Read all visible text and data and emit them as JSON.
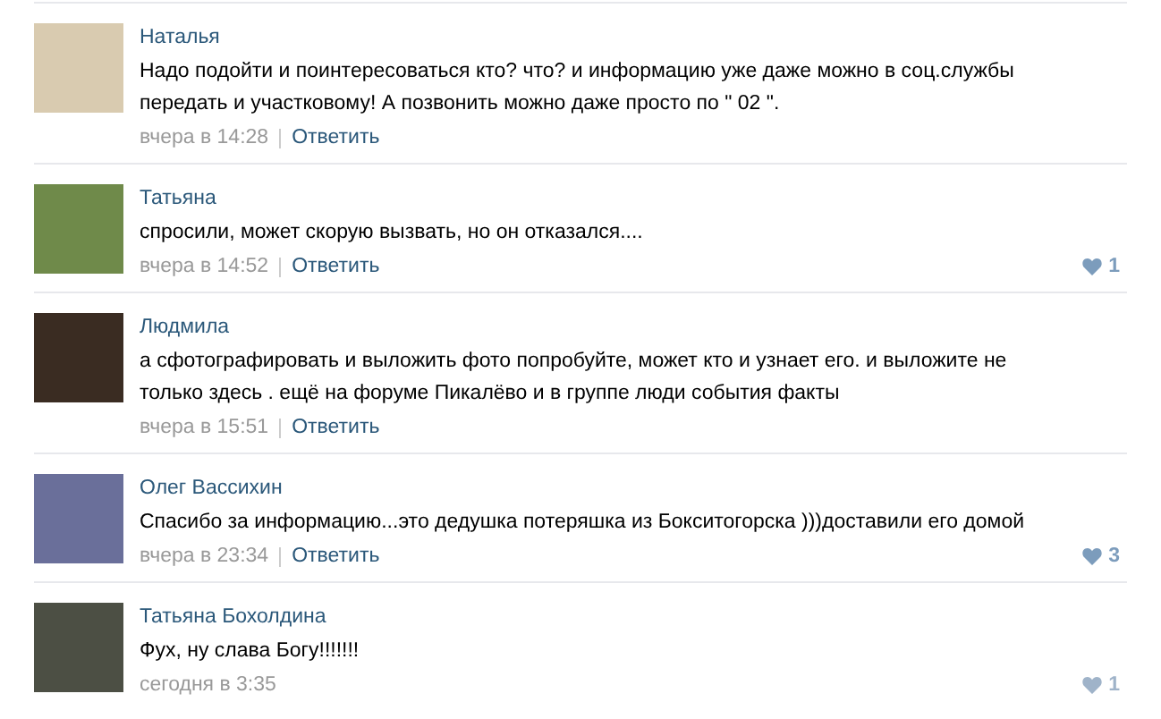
{
  "comments": [
    {
      "author": "Наталья",
      "text": "Надо подойти и поинтересоваться кто? что? и информацию уже даже можно в соц.службы передать и участковому! А позвонить можно даже просто по \" 02 \".",
      "time": "вчера в 14:28",
      "reply": "Ответить"
    },
    {
      "author": "Татьяна",
      "text": "спросили, может скорую вызвать, но он отказался....",
      "time": "вчера в 14:52",
      "reply": "Ответить",
      "likes": {
        "count": "1",
        "highlighted": true
      }
    },
    {
      "author": "Людмила",
      "text": "а сфотографировать и выложить фото попробуйте, может кто и узнает его. и выложите не только здесь . ещё на форуме Пикалёво и в группе люди события факты",
      "time": "вчера в 15:51",
      "reply": "Ответить"
    },
    {
      "author": "Олег Вассихин",
      "text": "Спасибо за информацию...это дедушка потеряшка из Бокситогорска )))доставили его домой",
      "time": "вчера в 23:34",
      "reply": "Ответить",
      "likes": {
        "count": "3",
        "highlighted": true
      }
    },
    {
      "author": "Татьяна Бохолдина",
      "text": "Фух, ну слава Богу!!!!!!!",
      "time": "сегодня в 3:35",
      "likes": {
        "count": "1",
        "highlighted": false
      }
    }
  ]
}
